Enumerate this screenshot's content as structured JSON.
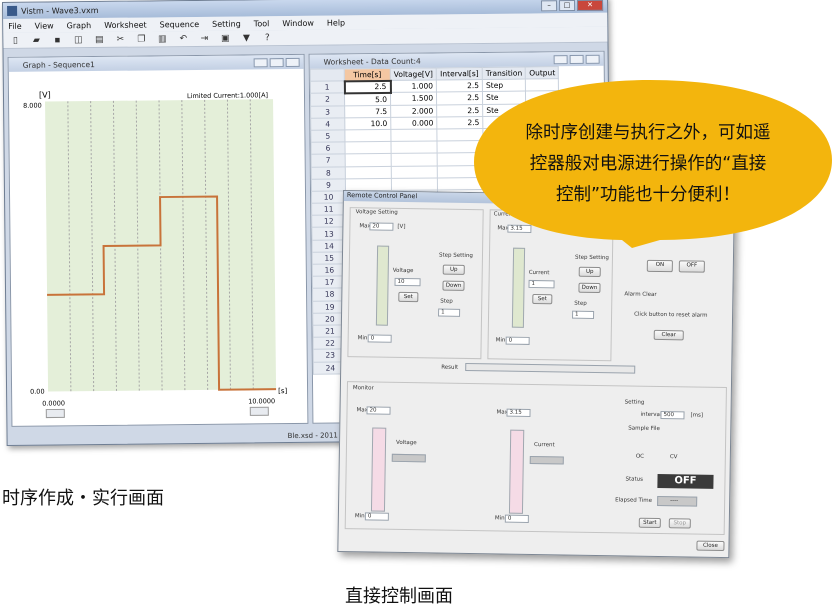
{
  "window": {
    "title": "Vistm - Wave3.vxm",
    "menu": [
      "File",
      "View",
      "Graph",
      "Worksheet",
      "Sequence",
      "Setting",
      "Tool",
      "Window",
      "Help"
    ]
  },
  "graph_pane": {
    "title": "Graph - Sequence1",
    "y_unit": "[V]",
    "limited_current": "Limited Current:1.000[A]",
    "y_max_label": "8.000",
    "y_min_label": "0.00",
    "x_min_label": "0.0000",
    "x_max_label": "10.0000",
    "x_unit": "[s]",
    "line_color": "#c8733a",
    "plot_bg": "#e4efd9"
  },
  "worksheet": {
    "title": "Worksheet - Data Count:4",
    "columns": [
      "Time[s]",
      "Voltage[V]",
      "Interval[s]",
      "Transition",
      "Output"
    ],
    "rows": [
      {
        "n": "1",
        "time": "2.5",
        "voltage": "1.000",
        "interval": "2.5",
        "transition": "Step",
        "output": ""
      },
      {
        "n": "2",
        "time": "5.0",
        "voltage": "1.500",
        "interval": "2.5",
        "transition": "Ste",
        "output": ""
      },
      {
        "n": "3",
        "time": "7.5",
        "voltage": "2.000",
        "interval": "2.5",
        "transition": "Ste",
        "output": ""
      },
      {
        "n": "4",
        "time": "10.0",
        "voltage": "0.000",
        "interval": "2.5",
        "transition": "",
        "output": ""
      }
    ],
    "row_numbers": [
      "5",
      "6",
      "7",
      "8",
      "9",
      "10",
      "11",
      "12",
      "13",
      "14",
      "15",
      "16",
      "17",
      "18",
      "19",
      "20",
      "21",
      "22",
      "23",
      "24"
    ],
    "status": "Ble.xsd - 2011 08"
  },
  "remote": {
    "title": "Remote Control Panel",
    "voltage_setting": "Voltage Setting",
    "current_setting": "Current Setting",
    "max_label": "Max",
    "min_label": "Min",
    "max_v": "20",
    "max_c": "3.15",
    "min_v": "0",
    "min_c": "0",
    "unit_v": "[V]",
    "unit_a": "[A]",
    "voltage_label": "Voltage",
    "current_label": "Current",
    "voltage_value": "10",
    "current_value": "1",
    "set_label": "Set",
    "step_setting": "Step Setting",
    "up_label": "Up",
    "down_label": "Down",
    "step_label": "Step",
    "step_value": "1",
    "on_label": "ON",
    "off_label": "OFF",
    "alarm_clear": "Alarm Clear",
    "alarm_msg": "Click button to reset alarm",
    "clear_label": "Clear",
    "monitor": "Monitor",
    "setting": "Setting",
    "interval_label": "interval",
    "interval_value": "500",
    "interval_unit": "[ms]",
    "sample_label": "Sample File",
    "ch_label_a": "OC",
    "ch_label_b": "CV",
    "status_label": "Status",
    "status_value": "OFF",
    "elapsed_label": "Elapsed Time",
    "elapsed_value": "----",
    "start_label": "Start",
    "stop_label": "Stop",
    "close_label": "Close",
    "result_label": "Result",
    "voltage_cb": "Voltage",
    "current_cb": "Current"
  },
  "callout": {
    "line1": "除时序创建与执行之外，可如遥",
    "line2": "控器般对电源进行操作的“直接",
    "line3": "控制”功能也十分便利！",
    "color": "#f3b50d"
  },
  "captions": {
    "left": "时序作成・实行画面",
    "right": "直接控制画面"
  },
  "chart_data": {
    "type": "line",
    "x": [
      0,
      2.5,
      2.5,
      5.0,
      5.0,
      7.5,
      7.5,
      10.0
    ],
    "y": [
      1.0,
      1.0,
      1.5,
      1.5,
      2.0,
      2.0,
      0.0,
      0.0
    ],
    "xlim": [
      0,
      10
    ],
    "ylim": [
      0,
      3
    ],
    "xlabel": "[s]",
    "ylabel": "[V]"
  }
}
